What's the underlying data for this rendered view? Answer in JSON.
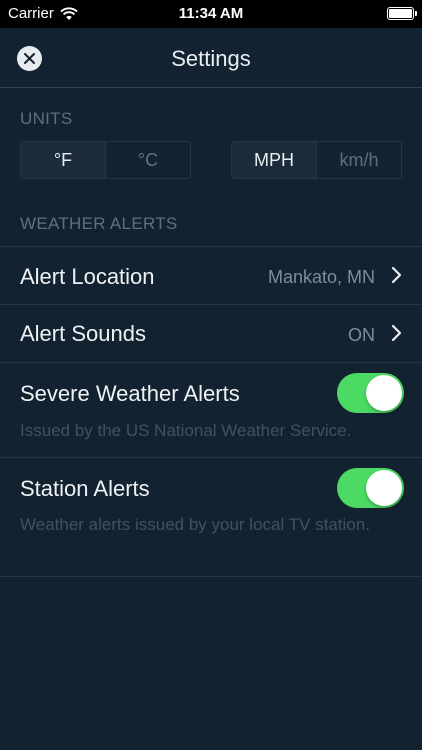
{
  "status_bar": {
    "carrier": "Carrier",
    "time": "11:34 AM",
    "battery_level": 1.0
  },
  "nav": {
    "title": "Settings",
    "close_icon": "close-icon"
  },
  "units": {
    "header": "UNITS",
    "temperature": {
      "options": [
        "°F",
        "°C"
      ],
      "selected": "°F"
    },
    "speed": {
      "options": [
        "MPH",
        "km/h"
      ],
      "selected": "MPH"
    }
  },
  "weather_alerts": {
    "header": "WEATHER ALERTS",
    "alert_location": {
      "label": "Alert Location",
      "value": "Mankato, MN"
    },
    "alert_sounds": {
      "label": "Alert Sounds",
      "value": "ON"
    },
    "severe_weather": {
      "label": "Severe Weather Alerts",
      "description": "Issued by the US National Weather Service.",
      "enabled": true
    },
    "station_alerts": {
      "label": "Station Alerts",
      "description": "Weather alerts issued by your local TV station.",
      "enabled": true
    }
  },
  "colors": {
    "background": "#132230",
    "toggle_on": "#4cd964",
    "muted_text": "#5e7080"
  }
}
